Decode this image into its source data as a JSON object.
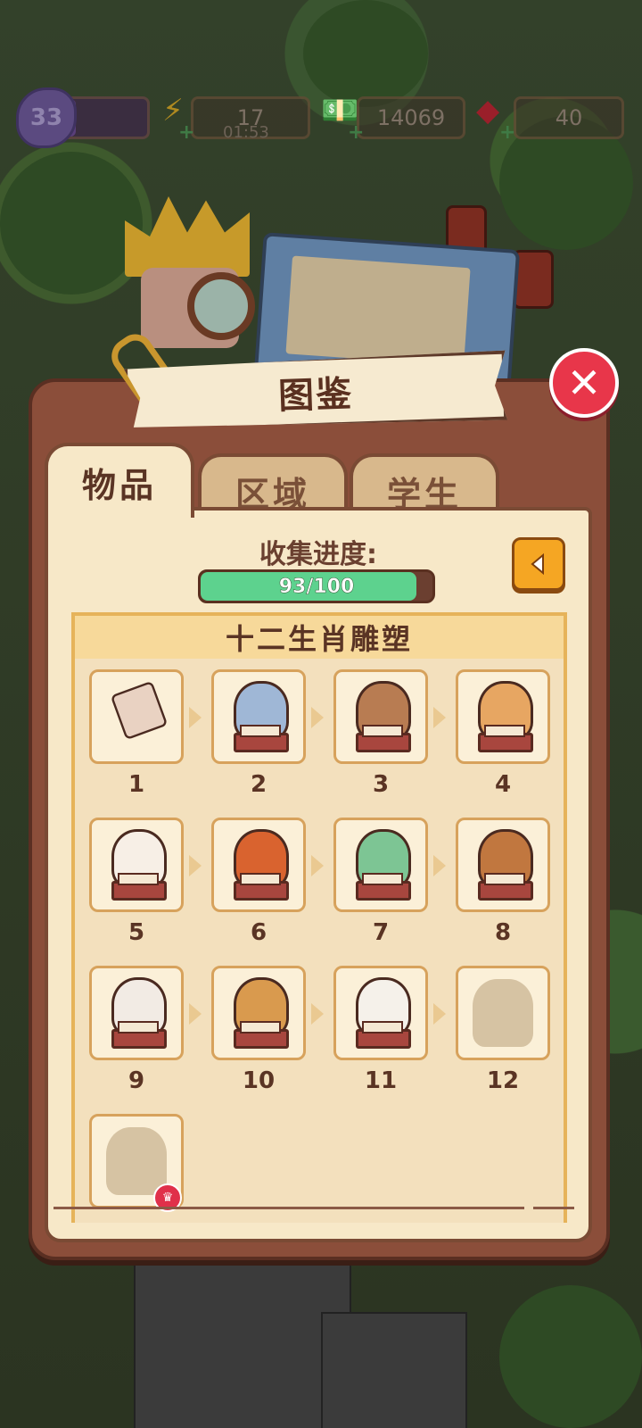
{
  "hud": {
    "level": "33",
    "xp_fraction": 0.2,
    "energy": "17",
    "energy_timer": "01:53",
    "cash": "14069",
    "gems": "40"
  },
  "panel": {
    "title": "图鉴",
    "close_icon": "close-icon",
    "tabs": [
      {
        "label": "物品",
        "active": true
      },
      {
        "label": "区域",
        "active": false
      },
      {
        "label": "学生",
        "active": false
      }
    ],
    "progress_label": "收集进度:",
    "progress_text": "93/100",
    "progress_fraction": 0.93,
    "set_title": "十二生肖雕塑",
    "items": [
      {
        "num": "1",
        "name": "clay-pieces",
        "color": "#e9d2c2"
      },
      {
        "num": "2",
        "name": "rat-statue",
        "color": "#9fb7d6"
      },
      {
        "num": "3",
        "name": "ox-statue",
        "color": "#b87c52"
      },
      {
        "num": "4",
        "name": "tiger-statue",
        "color": "#e7a662"
      },
      {
        "num": "5",
        "name": "rabbit-statue",
        "color": "#f7efe6"
      },
      {
        "num": "6",
        "name": "dragon-statue",
        "color": "#d9632f"
      },
      {
        "num": "7",
        "name": "snake-statue",
        "color": "#7dc594"
      },
      {
        "num": "8",
        "name": "horse-statue",
        "color": "#c1773f"
      },
      {
        "num": "9",
        "name": "sheep-statue",
        "color": "#f2ebe4"
      },
      {
        "num": "10",
        "name": "monkey-statue",
        "color": "#d99a4e"
      },
      {
        "num": "11",
        "name": "rooster-statue",
        "color": "#f5f1ea"
      },
      {
        "num": "12",
        "name": "dog-statue-locked",
        "color": "#d6c3a3"
      },
      {
        "num": "",
        "name": "pig-statue-locked",
        "color": "#d6c3a3"
      }
    ]
  }
}
